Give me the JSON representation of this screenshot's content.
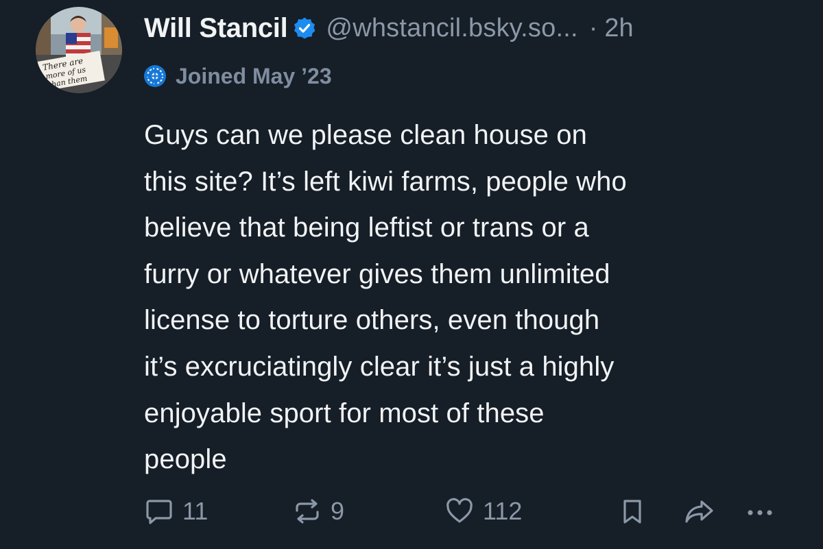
{
  "author": {
    "display_name": "Will Stancil",
    "handle": "@whstancil.bsky.so...",
    "separator": "·",
    "timestamp": "2h",
    "joined": "Joined May ’23",
    "avatar_sign_text": [
      "There are",
      "more of us",
      "than them"
    ]
  },
  "post": {
    "lines": [
      "Guys can we please clean house on",
      "this site? It’s left kiwi farms, people who",
      "believe that being leftist or trans or a",
      "furry or whatever gives them unlimited",
      "license to torture others, even though",
      "it’s excruciatingly clear it’s just a highly",
      "enjoyable sport for most of these",
      "people"
    ]
  },
  "actions": {
    "reply_count": "11",
    "repost_count": "9",
    "like_count": "112",
    "icons": [
      "reply-icon",
      "repost-icon",
      "like-icon",
      "bookmark-icon",
      "share-icon",
      "more-icon"
    ]
  },
  "colors": {
    "background": "#161e27",
    "text": "#f1f3f5",
    "muted": "#8b98a8",
    "verified": "#1d8cf0"
  }
}
